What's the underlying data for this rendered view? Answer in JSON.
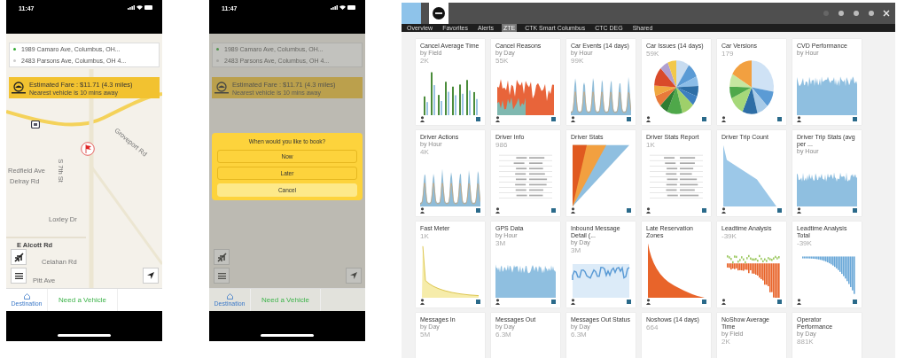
{
  "phones": [
    {
      "status_time": "11:47",
      "dimmed": false,
      "route": {
        "from": "1989 Camaro Ave, Columbus, OH...",
        "to": "2483 Parsons Ave, Columbus, OH 4..."
      },
      "fare": {
        "label": "Estimated Fare : $11.71 (4.3 miles)",
        "note": "Nearest vehicle is 10 mins away"
      },
      "map_labels": [
        "S 7th St",
        "Groveport Rd",
        "Redfield Ave",
        "Delray Rd",
        "Loxley Dr",
        "E Alcott Rd",
        "Celahan Rd",
        "Pitt Ave"
      ],
      "tab_bar": {
        "items": [
          {
            "label": "Destination",
            "selected": true
          }
        ],
        "action": "Need a Vehicle"
      }
    },
    {
      "status_time": "11:47",
      "dimmed": true,
      "route": {
        "from": "1989 Camaro Ave, Columbus, OH...",
        "to": "2483 Parsons Ave, Columbus, OH 4..."
      },
      "fare": {
        "label": "Estimated Fare : $11.71 (4.3 miles)",
        "note": "Nearest vehicle is 10 mins away"
      },
      "dialog": {
        "title": "When would you like to book?",
        "buttons": [
          {
            "label": "Now",
            "kind": "option"
          },
          {
            "label": "Later",
            "kind": "option"
          },
          {
            "label": "Cancel",
            "kind": "cancel"
          }
        ]
      },
      "tab_bar": {
        "items": [
          {
            "label": "Destination",
            "selected": true
          }
        ],
        "action": "Need a Vehicle"
      }
    }
  ],
  "dashboard": {
    "nav": [
      {
        "label": "Overview",
        "selected": false
      },
      {
        "label": "Favorites",
        "selected": false
      },
      {
        "label": "Alerts",
        "selected": false
      },
      {
        "label": "ZTE",
        "selected": true
      },
      {
        "label": "CTK Smart Columbus",
        "selected": false
      },
      {
        "label": "CTC DEG",
        "selected": false
      },
      {
        "label": "Shared",
        "selected": false
      }
    ],
    "cards": [
      {
        "title": "Cancel Average Time",
        "subtitle": "by Field",
        "value": "2K",
        "kind": "bars"
      },
      {
        "title": "Cancel Reasons",
        "subtitle": "by Day",
        "value": "55K",
        "kind": "spikes"
      },
      {
        "title": "Car Events (14 days)",
        "subtitle": "by Hour",
        "value": "99K",
        "kind": "peaks"
      },
      {
        "title": "Car Issues (14 days)",
        "value": "59K",
        "kind": "pie"
      },
      {
        "title": "Car Versions",
        "value": "179",
        "kind": "pie2"
      },
      {
        "title": "CVD Performance",
        "subtitle": "by Hour",
        "kind": "area"
      },
      {
        "title": "Driver Actions",
        "subtitle": "by Hour",
        "value": "4K",
        "kind": "peaks"
      },
      {
        "title": "Driver Info",
        "value": "986",
        "kind": "table"
      },
      {
        "title": "Driver Stats",
        "kind": "wedge"
      },
      {
        "title": "Driver Stats Report",
        "value": "1K",
        "kind": "table"
      },
      {
        "title": "Driver Trip Count",
        "kind": "decline"
      },
      {
        "title": "Driver Trip Stats (avg per ...",
        "subtitle": "by Hour",
        "kind": "area"
      },
      {
        "title": "Fast Meter",
        "value": "1K",
        "kind": "decay"
      },
      {
        "title": "GPS Data",
        "subtitle": "by Hour",
        "value": "3M",
        "kind": "area"
      },
      {
        "title": "Inbound Message Detail (...",
        "subtitle": "by Day",
        "value": "3M",
        "kind": "band"
      },
      {
        "title": "Late Reservation Zones",
        "kind": "orange-decline"
      },
      {
        "title": "Leadtime Analysis",
        "value": "-39K",
        "kind": "diverge"
      },
      {
        "title": "Leadtime Analysis Total",
        "value": "-39K",
        "kind": "diverge2"
      },
      {
        "title": "Messages In",
        "subtitle": "by Day",
        "value": "5M"
      },
      {
        "title": "Messages Out",
        "subtitle": "by Day",
        "value": "6.3M"
      },
      {
        "title": "Messages Out Status",
        "subtitle": "by Day",
        "value": "6.3M"
      },
      {
        "title": "Noshows (14 days)",
        "value": "664"
      },
      {
        "title": "NoShow Average Time",
        "subtitle": "by Field",
        "value": "2K"
      },
      {
        "title": "Operator Performance",
        "subtitle": "by Day",
        "value": "881K"
      }
    ]
  }
}
